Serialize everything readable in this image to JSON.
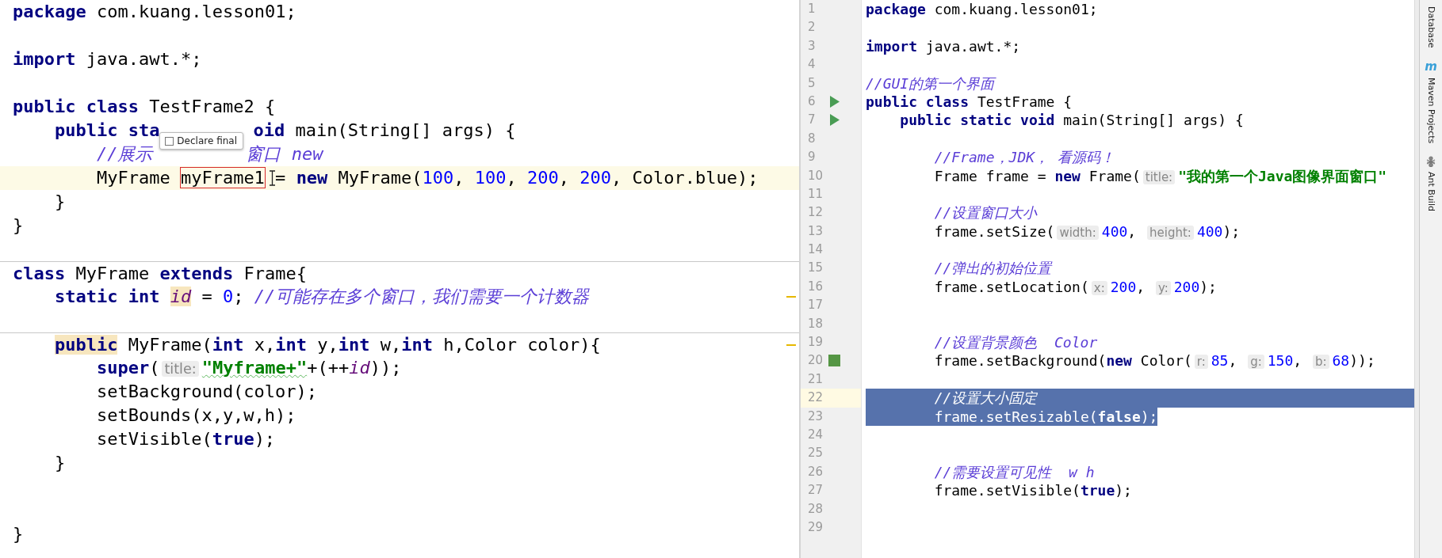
{
  "left_editor": {
    "lines": [
      {
        "tokens": [
          {
            "kind": "kw",
            "text": "package"
          },
          {
            "kind": "plain",
            "text": " com.kuang.lesson01;"
          }
        ],
        "current": false,
        "separator": false,
        "marker": false
      },
      {
        "current": false,
        "separator": false,
        "marker": false
      },
      {
        "tokens": [
          {
            "kind": "kw",
            "text": "import"
          },
          {
            "kind": "plain",
            "text": " java.awt.*;"
          }
        ],
        "current": false,
        "separator": false,
        "marker": false
      },
      {
        "current": false,
        "separator": false,
        "marker": false
      },
      {
        "tokens": [
          {
            "kind": "kw",
            "text": "public class"
          },
          {
            "kind": "plain",
            "text": " TestFrame2 {"
          }
        ],
        "current": false,
        "separator": false,
        "marker": false
      },
      {
        "tokens": [
          {
            "kind": "indent"
          },
          {
            "kind": "kw",
            "text": "public sta"
          },
          {
            "kind": "covered"
          },
          {
            "kind": "kw",
            "text": "oid"
          },
          {
            "kind": "plain",
            "text": " main(String[] args) {"
          }
        ],
        "current": false,
        "separator": false,
        "marker": false,
        "popup": {
          "label": "Declare final",
          "checked": false
        }
      },
      {
        "tokens": [
          {
            "kind": "indent"
          },
          {
            "kind": "indent"
          },
          {
            "kind": "comment",
            "text": "//展示"
          },
          {
            "kind": "covered"
          },
          {
            "kind": "comment",
            "text": "窗口 new"
          }
        ],
        "current": false,
        "separator": false,
        "marker": false
      },
      {
        "tokens": [
          {
            "kind": "indent"
          },
          {
            "kind": "indent"
          },
          {
            "kind": "plain",
            "text": "MyFrame "
          },
          {
            "kind": "rename",
            "text": "myFrame1"
          },
          {
            "kind": "plain",
            "text": " = "
          },
          {
            "kind": "kw",
            "text": "new"
          },
          {
            "kind": "plain",
            "text": " MyFrame("
          },
          {
            "kind": "num",
            "text": "100"
          },
          {
            "kind": "plain",
            "text": ", "
          },
          {
            "kind": "num",
            "text": "100"
          },
          {
            "kind": "plain",
            "text": ", "
          },
          {
            "kind": "num",
            "text": "200"
          },
          {
            "kind": "plain",
            "text": ", "
          },
          {
            "kind": "num",
            "text": "200"
          },
          {
            "kind": "plain",
            "text": ", Color.blue);"
          }
        ],
        "current": true,
        "separator": false,
        "marker": false,
        "pointer": {
          "kind": "text"
        }
      },
      {
        "tokens": [
          {
            "kind": "indent"
          },
          {
            "kind": "plain",
            "text": "}"
          }
        ],
        "current": false,
        "separator": false,
        "marker": false
      },
      {
        "tokens": [
          {
            "kind": "plain",
            "text": "}"
          }
        ],
        "current": false,
        "separator": false,
        "marker": false
      },
      {
        "current": false,
        "separator": false,
        "marker": false
      },
      {
        "tokens": [
          {
            "kind": "kw",
            "text": "class"
          },
          {
            "kind": "plain",
            "text": " MyFrame "
          },
          {
            "kind": "kw",
            "text": "extends"
          },
          {
            "kind": "plain",
            "text": " Frame{"
          }
        ],
        "current": false,
        "separator": true,
        "marker": false
      },
      {
        "tokens": [
          {
            "kind": "indent"
          },
          {
            "kind": "kw",
            "text": "static int "
          },
          {
            "kind": "field",
            "text": "id",
            "hl": true
          },
          {
            "kind": "plain",
            "text": " = "
          },
          {
            "kind": "num",
            "text": "0"
          },
          {
            "kind": "plain",
            "text": "; "
          },
          {
            "kind": "comment",
            "text": "//可能存在多个窗口，我们需要一个计数器"
          }
        ],
        "current": false,
        "separator": false,
        "marker": true
      },
      {
        "current": false,
        "separator": false,
        "marker": false
      },
      {
        "tokens": [
          {
            "kind": "indent"
          },
          {
            "kind": "kw",
            "text": "public",
            "hl": true
          },
          {
            "kind": "plain",
            "text": " MyFrame("
          },
          {
            "kind": "kw",
            "text": "int"
          },
          {
            "kind": "plain",
            "text": " x,"
          },
          {
            "kind": "kw",
            "text": "int"
          },
          {
            "kind": "plain",
            "text": " y,"
          },
          {
            "kind": "kw",
            "text": "int"
          },
          {
            "kind": "plain",
            "text": " w,"
          },
          {
            "kind": "kw",
            "text": "int"
          },
          {
            "kind": "plain",
            "text": " h,Color color){"
          }
        ],
        "current": false,
        "separator": true,
        "marker": true
      },
      {
        "tokens": [
          {
            "kind": "indent"
          },
          {
            "kind": "indent"
          },
          {
            "kind": "kw",
            "text": "super"
          },
          {
            "kind": "plain",
            "text": "("
          },
          {
            "kind": "hint",
            "text": "title:"
          },
          {
            "kind": "str",
            "text": "\"Myframe+\"",
            "typo": true
          },
          {
            "kind": "plain",
            "text": "+(++"
          },
          {
            "kind": "field",
            "text": "id"
          },
          {
            "kind": "plain",
            "text": "));"
          }
        ],
        "current": false,
        "separator": false,
        "marker": false
      },
      {
        "tokens": [
          {
            "kind": "indent"
          },
          {
            "kind": "indent"
          },
          {
            "kind": "plain",
            "text": "setBackground(color);"
          }
        ],
        "current": false,
        "separator": false,
        "marker": false
      },
      {
        "tokens": [
          {
            "kind": "indent"
          },
          {
            "kind": "indent"
          },
          {
            "kind": "plain",
            "text": "setBounds(x,y,w,h);"
          }
        ],
        "current": false,
        "separator": false,
        "marker": false
      },
      {
        "tokens": [
          {
            "kind": "indent"
          },
          {
            "kind": "indent"
          },
          {
            "kind": "plain",
            "text": "setVisible("
          },
          {
            "kind": "kw",
            "text": "true"
          },
          {
            "kind": "plain",
            "text": ");"
          }
        ],
        "current": false,
        "separator": false,
        "marker": false
      },
      {
        "tokens": [
          {
            "kind": "indent"
          },
          {
            "kind": "plain",
            "text": "}"
          }
        ],
        "current": false,
        "separator": false,
        "marker": false
      },
      {
        "current": false,
        "separator": false,
        "marker": false
      },
      {
        "current": false,
        "separator": false,
        "marker": false
      },
      {
        "tokens": [
          {
            "kind": "plain",
            "text": "}"
          }
        ],
        "current": false,
        "separator": false,
        "marker": false
      }
    ]
  },
  "right_editor": {
    "lines": [
      {
        "number": "1",
        "tokens": [
          {
            "kind": "kw",
            "text": "package"
          },
          {
            "kind": "plain",
            "text": " com.kuang.lesson01;"
          }
        ],
        "current": false,
        "selected": false
      },
      {
        "number": "2",
        "current": false,
        "selected": false
      },
      {
        "number": "3",
        "tokens": [
          {
            "kind": "kw",
            "text": "import"
          },
          {
            "kind": "plain",
            "text": " java.awt.*;"
          }
        ],
        "current": false,
        "selected": false
      },
      {
        "number": "4",
        "current": false,
        "selected": false
      },
      {
        "number": "5",
        "tokens": [
          {
            "kind": "comment",
            "text": "//GUI的第一个界面"
          }
        ],
        "current": false,
        "selected": false
      },
      {
        "number": "6",
        "tokens": [
          {
            "kind": "kw",
            "text": "public class"
          },
          {
            "kind": "plain",
            "text": " TestFrame {"
          }
        ],
        "current": false,
        "selected": false,
        "gutter": {
          "kind": "run"
        }
      },
      {
        "number": "7",
        "tokens": [
          {
            "kind": "indent"
          },
          {
            "kind": "kw",
            "text": "public static void"
          },
          {
            "kind": "plain",
            "text": " main(String[] args) {"
          }
        ],
        "current": false,
        "selected": false,
        "gutter": {
          "kind": "run"
        }
      },
      {
        "number": "8",
        "current": false,
        "selected": false
      },
      {
        "number": "9",
        "tokens": [
          {
            "kind": "indent"
          },
          {
            "kind": "indent"
          },
          {
            "kind": "comment",
            "text": "//Frame，JDK， 看源码！"
          }
        ],
        "current": false,
        "selected": false
      },
      {
        "number": "10",
        "tokens": [
          {
            "kind": "indent"
          },
          {
            "kind": "indent"
          },
          {
            "kind": "plain",
            "text": "Frame frame = "
          },
          {
            "kind": "kw",
            "text": "new"
          },
          {
            "kind": "plain",
            "text": " Frame("
          },
          {
            "kind": "hint",
            "text": "title:"
          },
          {
            "kind": "str",
            "text": "\"我的第一个Java图像界面窗口\""
          }
        ],
        "current": false,
        "selected": false
      },
      {
        "number": "11",
        "current": false,
        "selected": false
      },
      {
        "number": "12",
        "tokens": [
          {
            "kind": "indent"
          },
          {
            "kind": "indent"
          },
          {
            "kind": "comment",
            "text": "//设置窗口大小"
          }
        ],
        "current": false,
        "selected": false
      },
      {
        "number": "13",
        "tokens": [
          {
            "kind": "indent"
          },
          {
            "kind": "indent"
          },
          {
            "kind": "plain",
            "text": "frame.setSize("
          },
          {
            "kind": "hint",
            "text": "width:"
          },
          {
            "kind": "num",
            "text": "400"
          },
          {
            "kind": "plain",
            "text": ", "
          },
          {
            "kind": "hint",
            "text": "height:"
          },
          {
            "kind": "num",
            "text": "400"
          },
          {
            "kind": "plain",
            "text": ");"
          }
        ],
        "current": false,
        "selected": false
      },
      {
        "number": "14",
        "current": false,
        "selected": false
      },
      {
        "number": "15",
        "tokens": [
          {
            "kind": "indent"
          },
          {
            "kind": "indent"
          },
          {
            "kind": "comment",
            "text": "//弹出的初始位置"
          }
        ],
        "current": false,
        "selected": false
      },
      {
        "number": "16",
        "tokens": [
          {
            "kind": "indent"
          },
          {
            "kind": "indent"
          },
          {
            "kind": "plain",
            "text": "frame.setLocation("
          },
          {
            "kind": "hint",
            "text": "x:"
          },
          {
            "kind": "num",
            "text": "200"
          },
          {
            "kind": "plain",
            "text": ", "
          },
          {
            "kind": "hint",
            "text": "y:"
          },
          {
            "kind": "num",
            "text": "200"
          },
          {
            "kind": "plain",
            "text": ");"
          }
        ],
        "current": false,
        "selected": false
      },
      {
        "number": "17",
        "current": false,
        "selected": false
      },
      {
        "number": "18",
        "current": false,
        "selected": false
      },
      {
        "number": "19",
        "tokens": [
          {
            "kind": "indent"
          },
          {
            "kind": "indent"
          },
          {
            "kind": "comment",
            "text": "//设置背景颜色  Color"
          }
        ],
        "current": false,
        "selected": false
      },
      {
        "number": "20",
        "tokens": [
          {
            "kind": "indent"
          },
          {
            "kind": "indent"
          },
          {
            "kind": "plain",
            "text": "frame.setBackground("
          },
          {
            "kind": "kw",
            "text": "new"
          },
          {
            "kind": "plain",
            "text": " Color("
          },
          {
            "kind": "hint",
            "text": "r:"
          },
          {
            "kind": "num",
            "text": "85"
          },
          {
            "kind": "plain",
            "text": ", "
          },
          {
            "kind": "hint",
            "text": "g:"
          },
          {
            "kind": "num",
            "text": "150"
          },
          {
            "kind": "plain",
            "text": ", "
          },
          {
            "kind": "hint",
            "text": "b:"
          },
          {
            "kind": "num",
            "text": "68"
          },
          {
            "kind": "plain",
            "text": "));"
          }
        ],
        "current": false,
        "selected": false,
        "gutter": {
          "kind": "swatch",
          "color": "#559644"
        }
      },
      {
        "number": "21",
        "current": false,
        "selected": false
      },
      {
        "number": "22",
        "tokens": [
          {
            "kind": "indent"
          },
          {
            "kind": "indent"
          },
          {
            "kind": "comment",
            "text": "//设置大小固定"
          }
        ],
        "current": true,
        "selected": true
      },
      {
        "number": "23",
        "tokens": [
          {
            "kind": "indent"
          },
          {
            "kind": "indent"
          },
          {
            "kind": "plain",
            "text": "frame.setResizable("
          },
          {
            "kind": "kw",
            "text": "false"
          },
          {
            "kind": "plain",
            "text": ");"
          }
        ],
        "current": false,
        "selected": true
      },
      {
        "number": "24",
        "current": false,
        "selected": false
      },
      {
        "number": "25",
        "current": false,
        "selected": false
      },
      {
        "number": "26",
        "tokens": [
          {
            "kind": "indent"
          },
          {
            "kind": "indent"
          },
          {
            "kind": "comment",
            "text": "//需要设置可见性  w h"
          }
        ],
        "current": false,
        "selected": false
      },
      {
        "number": "27",
        "tokens": [
          {
            "kind": "indent"
          },
          {
            "kind": "indent"
          },
          {
            "kind": "plain",
            "text": "frame.setVisible("
          },
          {
            "kind": "kw",
            "text": "true"
          },
          {
            "kind": "plain",
            "text": ");"
          }
        ],
        "current": false,
        "selected": false
      },
      {
        "number": "28",
        "current": false,
        "selected": false
      },
      {
        "number": "29",
        "current": false,
        "selected": false
      }
    ]
  },
  "tool_strip": [
    {
      "kind": "plain",
      "label": "Database"
    },
    {
      "kind": "maven",
      "label": "Maven Projects",
      "icon_text": "m"
    },
    {
      "kind": "ant",
      "label": "Ant Build"
    }
  ]
}
